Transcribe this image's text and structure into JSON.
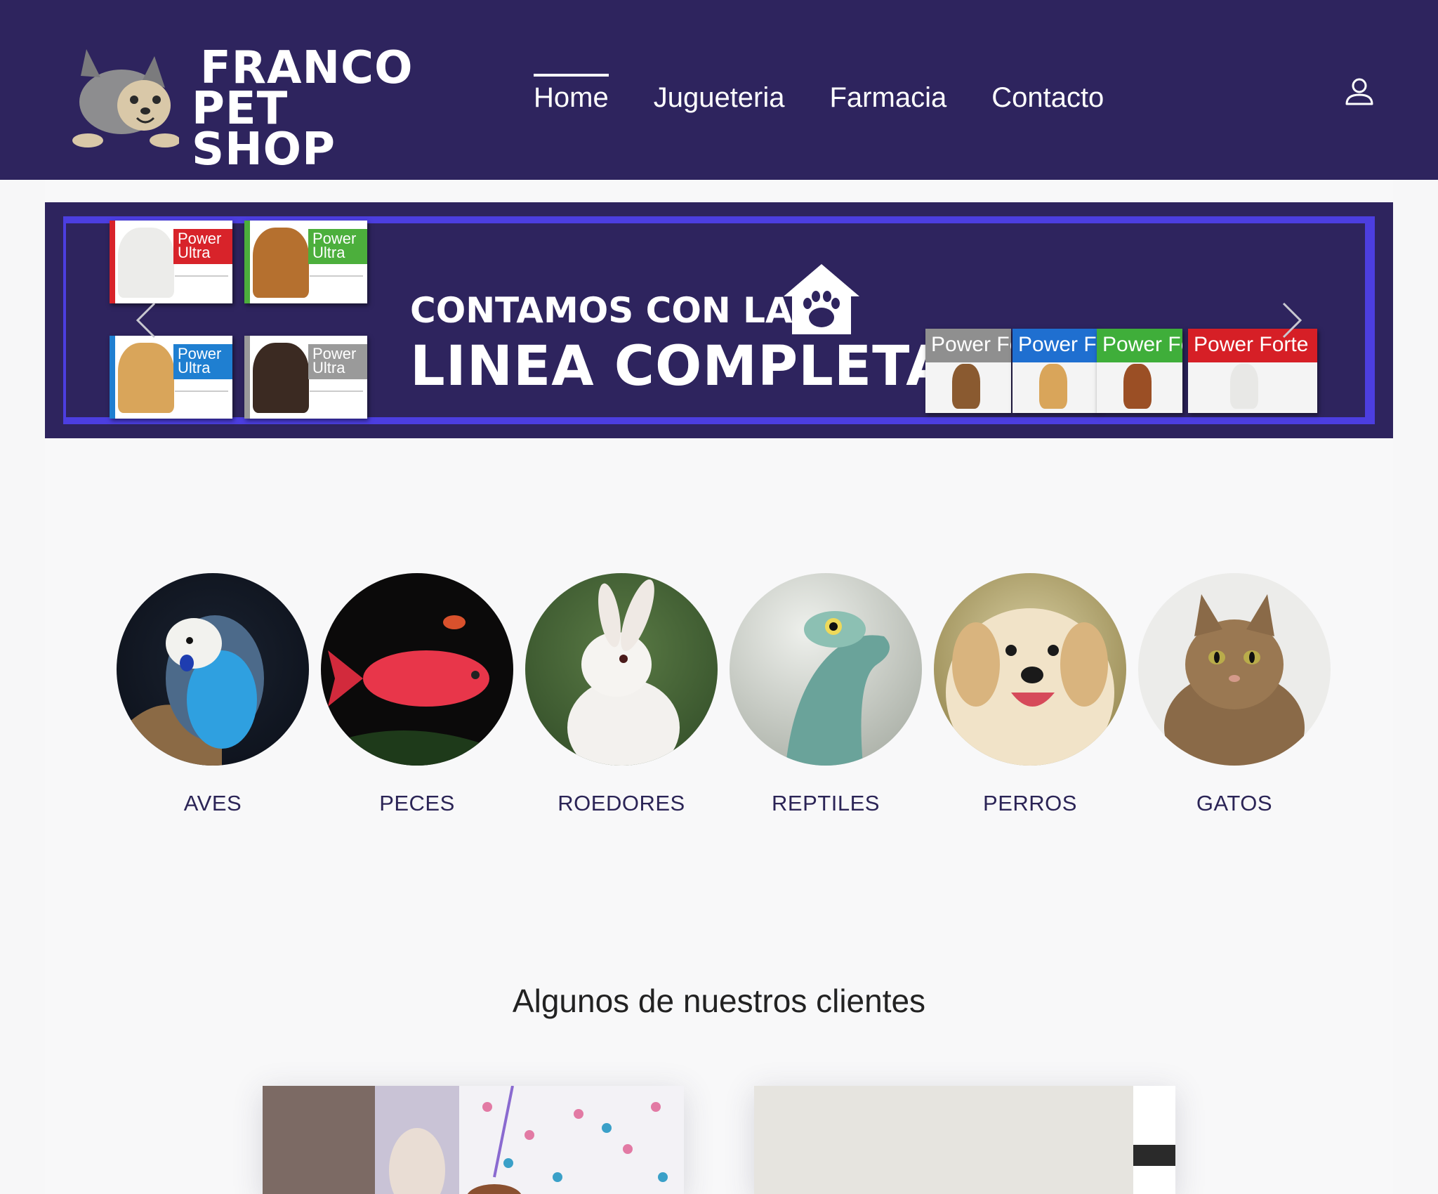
{
  "header": {
    "logo_line1": "FRANCO",
    "logo_line2": "PET SHOP",
    "nav": [
      {
        "label": "Home",
        "active": true
      },
      {
        "label": "Jugueteria",
        "active": false
      },
      {
        "label": "Farmacia",
        "active": false
      },
      {
        "label": "Contacto",
        "active": false
      }
    ],
    "user_icon": "user-icon"
  },
  "banner": {
    "line1": "CONTAMOS CON LA",
    "line2": "LINEA COMPLETA",
    "left_products": [
      {
        "brand": "Power",
        "sub": "Ultra",
        "color": "#d8232a"
      },
      {
        "brand": "Power",
        "sub": "Ultra",
        "color": "#4caf3c"
      },
      {
        "brand": "Power",
        "sub": "Ultra",
        "color": "#1f7fd1"
      },
      {
        "brand": "Power",
        "sub": "Ultra",
        "color": "#9a9a9a"
      }
    ],
    "right_products": [
      {
        "brand": "Power Fo",
        "color": "#8f8f8f"
      },
      {
        "brand": "Power Fo",
        "color": "#1f6fd0"
      },
      {
        "brand": "Power Fo",
        "color": "#3fae3a"
      },
      {
        "brand": "Power Forte",
        "color": "#d61f26"
      }
    ],
    "icon": "house-paw-icon"
  },
  "categories": [
    {
      "label": "AVES"
    },
    {
      "label": "PECES"
    },
    {
      "label": "ROEDORES"
    },
    {
      "label": "REPTILES"
    },
    {
      "label": "PERROS"
    },
    {
      "label": "GATOS"
    }
  ],
  "clients": {
    "title": "Algunos de nuestros clientes"
  },
  "colors": {
    "brand": "#2e245e",
    "accent": "#4c3ee0",
    "category_text": "#2b2456"
  }
}
